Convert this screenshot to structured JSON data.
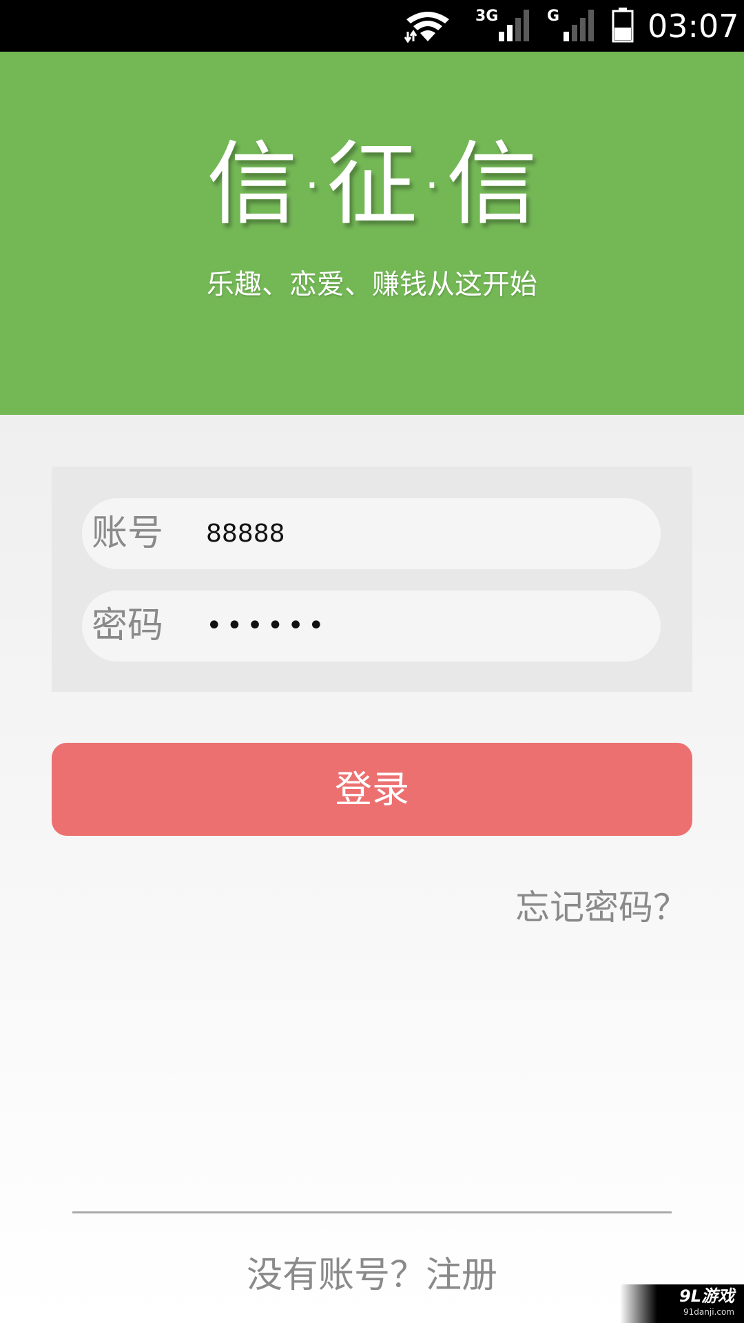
{
  "status_bar": {
    "network_3g_label": "3G",
    "network_g_label": "G",
    "time": "03:07",
    "icons": [
      "wifi-icon",
      "signal-icon",
      "signal-icon",
      "battery-icon"
    ]
  },
  "header": {
    "title": "信·征·信",
    "slogan": "乐趣、恋爱、赚钱从这开始"
  },
  "form": {
    "account_label": "账号",
    "account_value": "88888",
    "password_label": "密码",
    "password_value": "••••••"
  },
  "actions": {
    "login_label": "登录",
    "forgot_password_label": "忘记密码？",
    "register_label": "没有账号？注册"
  },
  "watermark": {
    "text": "9L游戏",
    "sub": "91danji.com"
  },
  "colors": {
    "header_bg": "#74b856",
    "login_button_bg": "#ec7070",
    "status_bar_bg": "#000000",
    "muted_text": "#8a8a8a"
  }
}
